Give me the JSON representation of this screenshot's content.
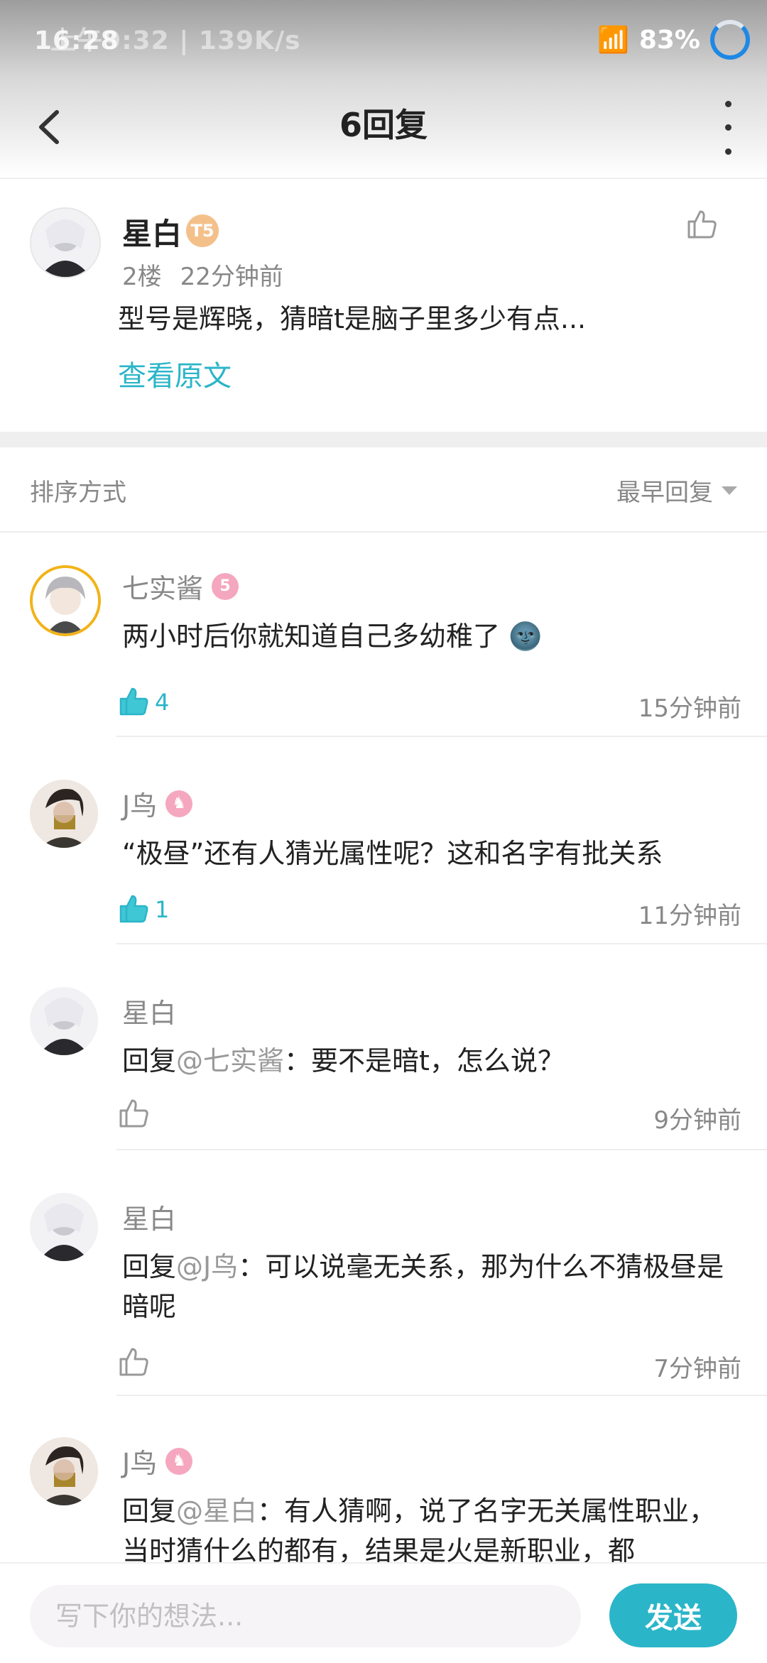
{
  "status_bar": {
    "time": "16:28",
    "network": "上午9:32 | 139K/s",
    "battery": "83%"
  },
  "header": {
    "title": "6回复"
  },
  "main_post": {
    "author": "星白",
    "badge": "T5",
    "floor": "2楼",
    "time": "22分钟前",
    "text": "型号是辉晓，猜暗t是脑子里多少有点...",
    "view_original": "查看原文"
  },
  "sort": {
    "label": "排序方式",
    "selected": "最早回复"
  },
  "replies": [
    {
      "author": "七实酱",
      "level": "5",
      "text": "两小时后你就知道自己多幼稚了",
      "emoji": "🌚",
      "likes": "4",
      "time": "15分钟前",
      "liked": true
    },
    {
      "author": "J鸟",
      "level": "♞",
      "text": "“极昼”还有人猜光属性呢？这和名字有批关系",
      "likes": "1",
      "time": "11分钟前",
      "liked": true
    },
    {
      "author": "星白",
      "prefix": "回复",
      "mention": "@七实酱",
      "text": "：要不是暗t，怎么说？",
      "time": "9分钟前",
      "liked": false
    },
    {
      "author": "星白",
      "prefix": "回复",
      "mention": "@J鸟",
      "text": "：可以说毫无关系，那为什么不猜极昼是暗呢",
      "time": "7分钟前",
      "liked": false
    },
    {
      "author": "J鸟",
      "level": "♞",
      "prefix": "回复",
      "mention": "@星白",
      "text": "：有人猜啊，说了名字无关属性职业，当时猜什么的都有，结果是火是新职业，都"
    }
  ],
  "composer": {
    "placeholder": "写下你的想法...",
    "send_label": "发送"
  },
  "colors": {
    "accent": "#2bb5c8",
    "level_badge": "#f5a7c0",
    "vip_badge": "#f4c08a"
  },
  "icons": [
    "back-arrow-icon",
    "more-vertical-icon",
    "thumbs-up-icon",
    "dropdown-triangle-icon"
  ]
}
